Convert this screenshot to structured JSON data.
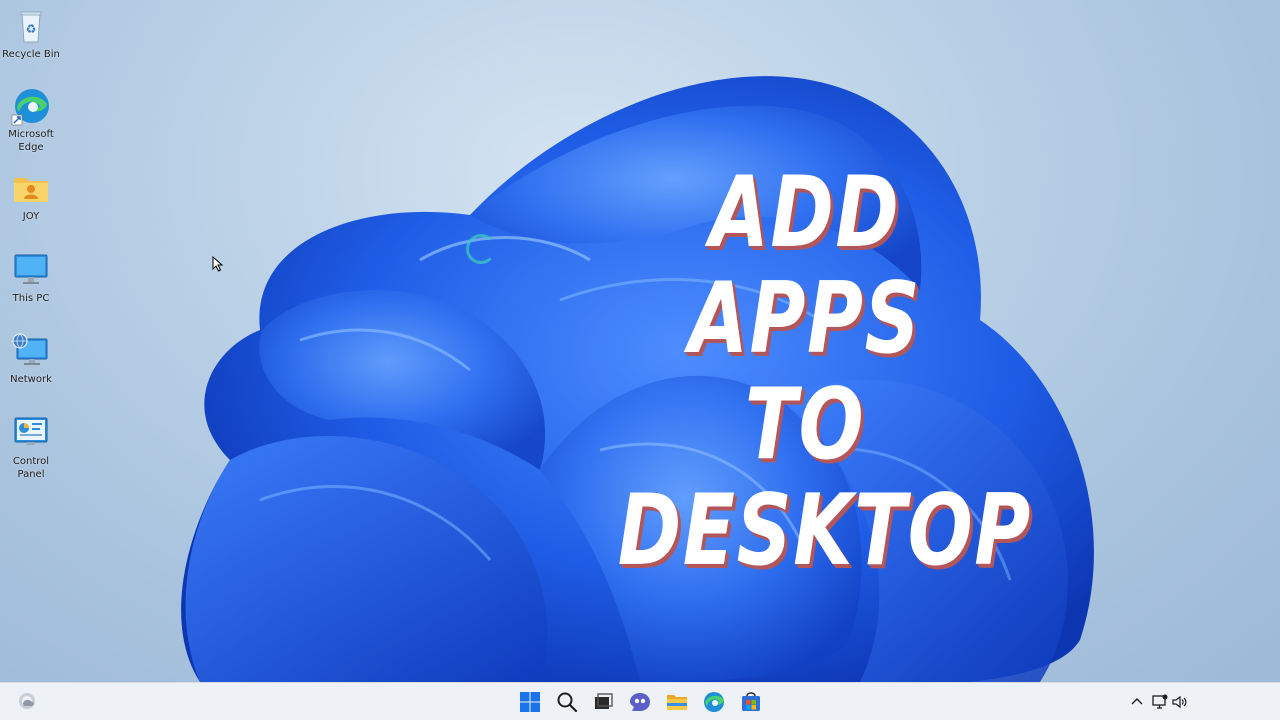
{
  "desktop_icons": [
    {
      "label": "Recycle Bin",
      "icon": "recycle-bin-icon"
    },
    {
      "label": "Microsoft Edge",
      "icon": "edge-icon"
    },
    {
      "label": "JOY",
      "icon": "user-folder-icon"
    },
    {
      "label": "This PC",
      "icon": "monitor-icon"
    },
    {
      "label": "Network",
      "icon": "network-icon"
    },
    {
      "label": "Control Panel",
      "icon": "control-panel-icon"
    }
  ],
  "overlay": {
    "line1": "ADD APPS",
    "line2": "TO",
    "line3": "DESKTOP"
  },
  "taskbar": {
    "pinned": [
      {
        "name": "start-button",
        "icon": "windows-icon"
      },
      {
        "name": "search-button",
        "icon": "search-icon"
      },
      {
        "name": "task-view-button",
        "icon": "task-view-icon"
      },
      {
        "name": "chat-button",
        "icon": "chat-icon"
      },
      {
        "name": "file-explorer-button",
        "icon": "folder-icon"
      },
      {
        "name": "edge-button",
        "icon": "edge-icon"
      },
      {
        "name": "store-button",
        "icon": "store-icon"
      }
    ],
    "tray": [
      "chevron-up-icon",
      "network-icon",
      "volume-icon"
    ]
  },
  "colors": {
    "accent": "#1a56e8",
    "title_shadow": "#b3565a",
    "taskbar_bg": "#eef1f6"
  }
}
